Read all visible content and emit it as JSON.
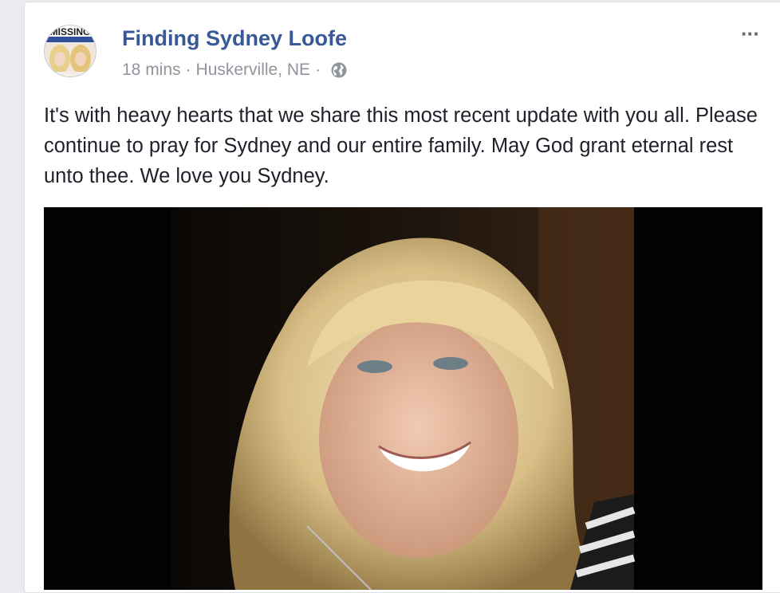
{
  "post": {
    "page_name": "Finding Sydney Loofe",
    "timestamp": "18 mins",
    "separator": "·",
    "location": "Huskerville, NE",
    "privacy_icon": "globe-icon",
    "more_label": "···",
    "text": "It's with heavy hearts that we share this most recent update with you all. Please continue to pray for Sydney and our entire family. May God grant eternal rest unto thee. We love you Sydney.",
    "avatar_text": "MISSING",
    "link_color": "#385898",
    "meta_color": "#90949c"
  }
}
